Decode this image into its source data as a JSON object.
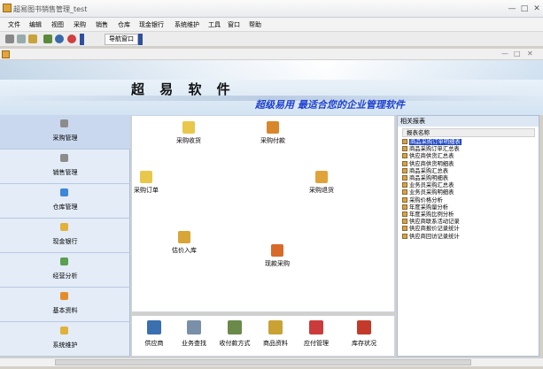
{
  "window": {
    "title": "超易图书销售管理_test",
    "controls": [
      "—",
      "□",
      "✕"
    ]
  },
  "menu": [
    "文件",
    "编辑",
    "视图",
    "采购",
    "销售",
    "仓库",
    "现金银行",
    "系统维护",
    "工具",
    "窗口",
    "帮助"
  ],
  "toolbar": {
    "nav_window_label": "导航窗口"
  },
  "inner_window": {
    "controls": [
      "—",
      "□",
      "✕"
    ]
  },
  "banner": {
    "brand": "超 易 软 件",
    "slogan": "超级易用  最适合您的企业管理软件"
  },
  "left_nav": [
    {
      "label": "采购管理",
      "active": true,
      "icon": "purchase-icon",
      "color": "#8c8c8c"
    },
    {
      "label": "销售管理",
      "active": false,
      "icon": "sales-icon",
      "color": "#8c8c8c"
    },
    {
      "label": "仓库管理",
      "active": false,
      "icon": "warehouse-icon",
      "color": "#3d86d8"
    },
    {
      "label": "现金银行",
      "active": false,
      "icon": "cash-bank-icon",
      "color": "#e2b13c"
    },
    {
      "label": "经营分析",
      "active": false,
      "icon": "analysis-icon",
      "color": "#5aa050"
    },
    {
      "label": "基本资料",
      "active": false,
      "icon": "basic-data-icon",
      "color": "#e58c2a"
    },
    {
      "label": "系统维护",
      "active": false,
      "icon": "maintenance-icon",
      "color": "#e0b23a"
    }
  ],
  "center_items": [
    {
      "label": "采购收货",
      "icon": "receive-icon",
      "color": "#e8c74a"
    },
    {
      "label": "采购付款",
      "icon": "payment-icon",
      "color": "#d8872a"
    },
    {
      "label": "采购订单",
      "icon": "order-icon",
      "color": "#e8c74a"
    },
    {
      "label": "采购退货",
      "icon": "return-icon",
      "color": "#e0a33a"
    },
    {
      "label": "估价入库",
      "icon": "valuation-icon",
      "color": "#d9a536"
    },
    {
      "label": "现款采购",
      "icon": "cash-purchase-icon",
      "color": "#d86a2a"
    }
  ],
  "quick_bar": [
    {
      "label": "供应商",
      "icon": "supplier-icon",
      "color": "#3a6fb0"
    },
    {
      "label": "业务查找",
      "icon": "search-business-icon",
      "color": "#7a8fa8"
    },
    {
      "label": "收付款方式",
      "icon": "payment-method-icon",
      "color": "#6a8a4a"
    },
    {
      "label": "商品资料",
      "icon": "goods-icon",
      "color": "#c9a233"
    },
    {
      "label": "应付管理",
      "icon": "payables-icon",
      "color": "#cc3b3b"
    },
    {
      "label": "库存状况",
      "icon": "inventory-icon",
      "color": "#c43a2a"
    }
  ],
  "report_panel": {
    "title": "相关报表",
    "column": "报表名称",
    "rows": [
      "商品采购订单明细表",
      "商品采购订单汇总表",
      "供应商供货汇总表",
      "供应商供货明细表",
      "商品采购汇总表",
      "商品采购明细表",
      "业务员采购汇总表",
      "业务员采购明细表",
      "采购价格分析",
      "年度采购量分析",
      "年度采购比例分析",
      "供应商联系活动记录",
      "供应商报价记录统计",
      "供应商回访记录统计"
    ],
    "selected_index": 0
  },
  "colors": {
    "accent": "#1c46c9",
    "slogan": "#1c3fd0",
    "nav_bg": "#e3ecf7",
    "nav_active": "#c9d8ee"
  }
}
